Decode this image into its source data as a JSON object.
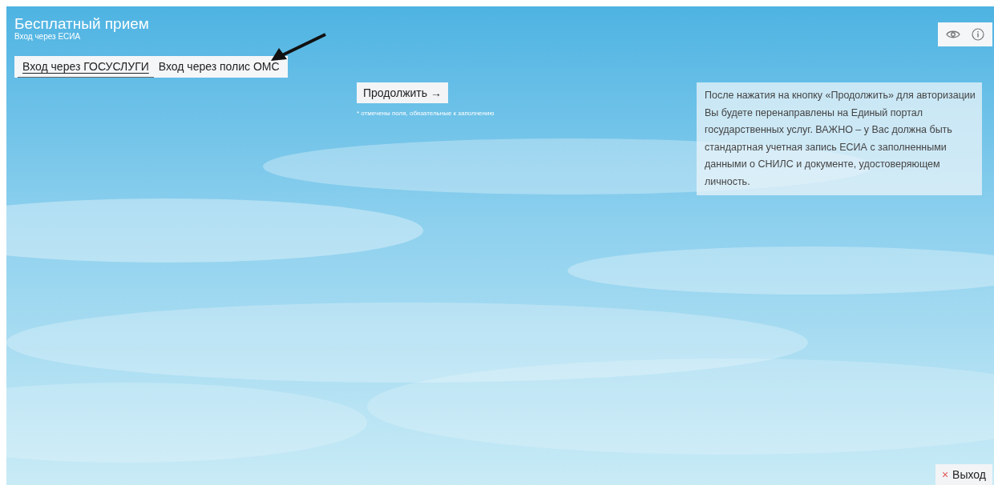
{
  "header": {
    "title": "Бесплатный прием",
    "subtitle": "Вход через ЕСИА"
  },
  "tabs": [
    {
      "label": "Вход через ГОСУСЛУГИ",
      "selected": true
    },
    {
      "label": "Вход через полис ОМС",
      "selected": false
    }
  ],
  "continue_button": {
    "label": "Продолжить →"
  },
  "required_note": "* отмечены поля, обязательные к заполнению",
  "info_text": "После нажатия на кнопку «Продолжить» для авторизации Вы будете перенаправлены на Единый портал государственных услуг. ВАЖНО – у Вас должна быть стандартная учетная запись  ЕСИА с заполненными данными о СНИЛС и документе, удостоверяющем личность.",
  "exit_button": {
    "icon": "×",
    "label": "Выход"
  }
}
